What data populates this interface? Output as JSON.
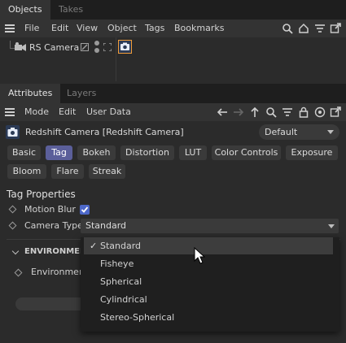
{
  "objects_panel": {
    "tabs": [
      {
        "label": "Objects"
      },
      {
        "label": "Takes"
      }
    ],
    "menu": [
      "File",
      "Edit",
      "View",
      "Object",
      "Tags",
      "Bookmarks"
    ],
    "tree": {
      "object_name": "RS Camera"
    }
  },
  "attributes_panel": {
    "tabs": [
      {
        "label": "Attributes"
      },
      {
        "label": "Layers"
      }
    ],
    "menu": [
      "Mode",
      "Edit",
      "User Data"
    ],
    "object_title": "Redshift Camera [Redshift Camera]",
    "preset": "Default",
    "tag_buttons": [
      "Basic",
      "Tag",
      "Bokeh",
      "Distortion",
      "LUT",
      "Color Controls",
      "Exposure",
      "Bloom",
      "Flare",
      "Streak"
    ],
    "active_tag_button": "Tag",
    "section_title": "Tag Properties",
    "motion_blur": {
      "label": "Motion Blur",
      "checked": true
    },
    "camera_type": {
      "label": "Camera Type",
      "value": "Standard"
    },
    "environment_group": {
      "label": "ENVIRONMENT"
    },
    "environment_row": {
      "label": "Environment"
    }
  },
  "camera_type_dropdown": {
    "options": [
      "Standard",
      "Fisheye",
      "Spherical",
      "Cylindrical",
      "Stereo-Spherical"
    ],
    "selected": "Standard"
  },
  "colors": {
    "accent": "#5b5f9a",
    "highlight": "#f29d38",
    "checkbox": "#4d68c9"
  }
}
